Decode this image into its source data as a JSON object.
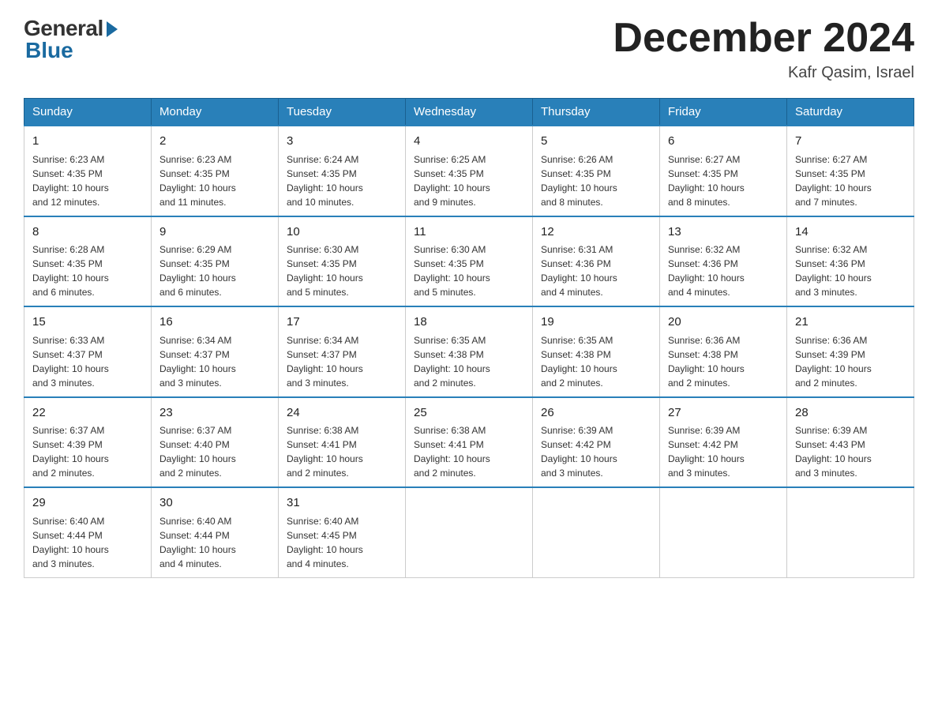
{
  "header": {
    "logo_general": "General",
    "logo_blue": "Blue",
    "title": "December 2024",
    "location": "Kafr Qasim, Israel"
  },
  "weekdays": [
    "Sunday",
    "Monday",
    "Tuesday",
    "Wednesday",
    "Thursday",
    "Friday",
    "Saturday"
  ],
  "weeks": [
    [
      {
        "day": "1",
        "sunrise": "6:23 AM",
        "sunset": "4:35 PM",
        "daylight": "10 hours and 12 minutes."
      },
      {
        "day": "2",
        "sunrise": "6:23 AM",
        "sunset": "4:35 PM",
        "daylight": "10 hours and 11 minutes."
      },
      {
        "day": "3",
        "sunrise": "6:24 AM",
        "sunset": "4:35 PM",
        "daylight": "10 hours and 10 minutes."
      },
      {
        "day": "4",
        "sunrise": "6:25 AM",
        "sunset": "4:35 PM",
        "daylight": "10 hours and 9 minutes."
      },
      {
        "day": "5",
        "sunrise": "6:26 AM",
        "sunset": "4:35 PM",
        "daylight": "10 hours and 8 minutes."
      },
      {
        "day": "6",
        "sunrise": "6:27 AM",
        "sunset": "4:35 PM",
        "daylight": "10 hours and 8 minutes."
      },
      {
        "day": "7",
        "sunrise": "6:27 AM",
        "sunset": "4:35 PM",
        "daylight": "10 hours and 7 minutes."
      }
    ],
    [
      {
        "day": "8",
        "sunrise": "6:28 AM",
        "sunset": "4:35 PM",
        "daylight": "10 hours and 6 minutes."
      },
      {
        "day": "9",
        "sunrise": "6:29 AM",
        "sunset": "4:35 PM",
        "daylight": "10 hours and 6 minutes."
      },
      {
        "day": "10",
        "sunrise": "6:30 AM",
        "sunset": "4:35 PM",
        "daylight": "10 hours and 5 minutes."
      },
      {
        "day": "11",
        "sunrise": "6:30 AM",
        "sunset": "4:35 PM",
        "daylight": "10 hours and 5 minutes."
      },
      {
        "day": "12",
        "sunrise": "6:31 AM",
        "sunset": "4:36 PM",
        "daylight": "10 hours and 4 minutes."
      },
      {
        "day": "13",
        "sunrise": "6:32 AM",
        "sunset": "4:36 PM",
        "daylight": "10 hours and 4 minutes."
      },
      {
        "day": "14",
        "sunrise": "6:32 AM",
        "sunset": "4:36 PM",
        "daylight": "10 hours and 3 minutes."
      }
    ],
    [
      {
        "day": "15",
        "sunrise": "6:33 AM",
        "sunset": "4:37 PM",
        "daylight": "10 hours and 3 minutes."
      },
      {
        "day": "16",
        "sunrise": "6:34 AM",
        "sunset": "4:37 PM",
        "daylight": "10 hours and 3 minutes."
      },
      {
        "day": "17",
        "sunrise": "6:34 AM",
        "sunset": "4:37 PM",
        "daylight": "10 hours and 3 minutes."
      },
      {
        "day": "18",
        "sunrise": "6:35 AM",
        "sunset": "4:38 PM",
        "daylight": "10 hours and 2 minutes."
      },
      {
        "day": "19",
        "sunrise": "6:35 AM",
        "sunset": "4:38 PM",
        "daylight": "10 hours and 2 minutes."
      },
      {
        "day": "20",
        "sunrise": "6:36 AM",
        "sunset": "4:38 PM",
        "daylight": "10 hours and 2 minutes."
      },
      {
        "day": "21",
        "sunrise": "6:36 AM",
        "sunset": "4:39 PM",
        "daylight": "10 hours and 2 minutes."
      }
    ],
    [
      {
        "day": "22",
        "sunrise": "6:37 AM",
        "sunset": "4:39 PM",
        "daylight": "10 hours and 2 minutes."
      },
      {
        "day": "23",
        "sunrise": "6:37 AM",
        "sunset": "4:40 PM",
        "daylight": "10 hours and 2 minutes."
      },
      {
        "day": "24",
        "sunrise": "6:38 AM",
        "sunset": "4:41 PM",
        "daylight": "10 hours and 2 minutes."
      },
      {
        "day": "25",
        "sunrise": "6:38 AM",
        "sunset": "4:41 PM",
        "daylight": "10 hours and 2 minutes."
      },
      {
        "day": "26",
        "sunrise": "6:39 AM",
        "sunset": "4:42 PM",
        "daylight": "10 hours and 3 minutes."
      },
      {
        "day": "27",
        "sunrise": "6:39 AM",
        "sunset": "4:42 PM",
        "daylight": "10 hours and 3 minutes."
      },
      {
        "day": "28",
        "sunrise": "6:39 AM",
        "sunset": "4:43 PM",
        "daylight": "10 hours and 3 minutes."
      }
    ],
    [
      {
        "day": "29",
        "sunrise": "6:40 AM",
        "sunset": "4:44 PM",
        "daylight": "10 hours and 3 minutes."
      },
      {
        "day": "30",
        "sunrise": "6:40 AM",
        "sunset": "4:44 PM",
        "daylight": "10 hours and 4 minutes."
      },
      {
        "day": "31",
        "sunrise": "6:40 AM",
        "sunset": "4:45 PM",
        "daylight": "10 hours and 4 minutes."
      },
      null,
      null,
      null,
      null
    ]
  ],
  "labels": {
    "sunrise": "Sunrise:",
    "sunset": "Sunset:",
    "daylight": "Daylight:"
  }
}
